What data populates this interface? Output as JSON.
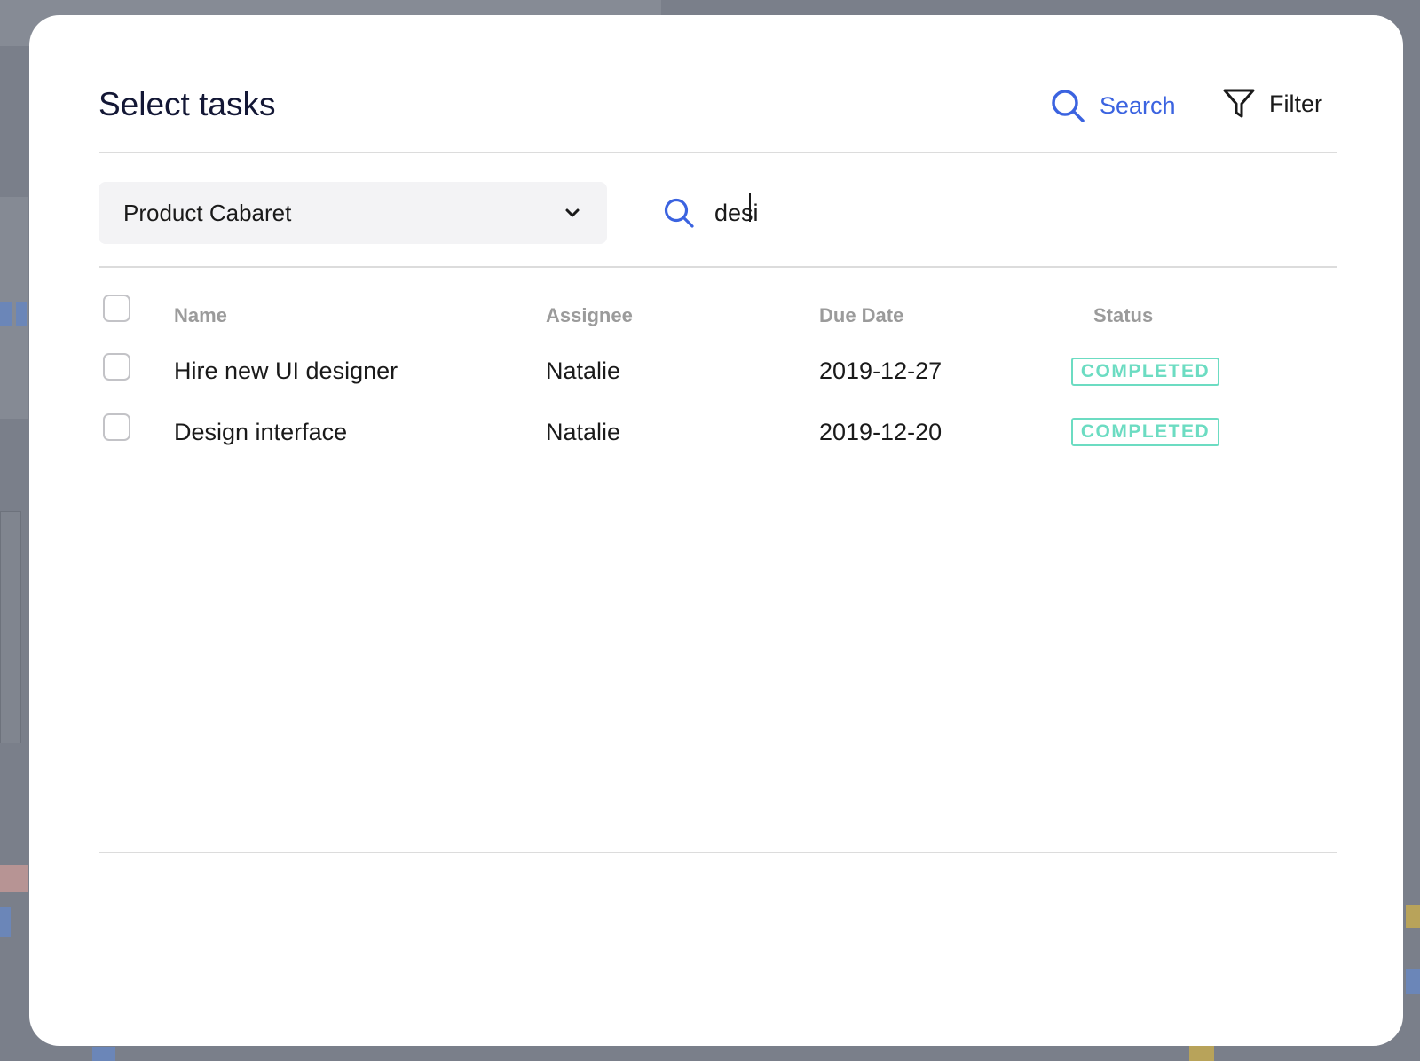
{
  "modal": {
    "title": "Select tasks",
    "search_action": {
      "label": "Search",
      "icon": "search-icon"
    },
    "filter_action": {
      "label": "Filter",
      "icon": "filter-icon"
    }
  },
  "toolbar": {
    "project_select": {
      "value": "Product Cabaret",
      "icon": "chevron-down-icon"
    },
    "search": {
      "value": "desi",
      "icon": "search-icon"
    }
  },
  "table": {
    "headers": {
      "name": "Name",
      "assignee": "Assignee",
      "due_date": "Due Date",
      "status": "Status"
    },
    "rows": [
      {
        "name": "Hire new UI designer",
        "assignee": "Natalie",
        "due_date": "2019-12-27",
        "status": "COMPLETED",
        "selected": false
      },
      {
        "name": "Design interface",
        "assignee": "Natalie",
        "due_date": "2019-12-20",
        "status": "COMPLETED",
        "selected": false
      }
    ]
  },
  "colors": {
    "accent": "#3b63e0",
    "status_completed": "#6cdcc2",
    "title": "#131735"
  }
}
